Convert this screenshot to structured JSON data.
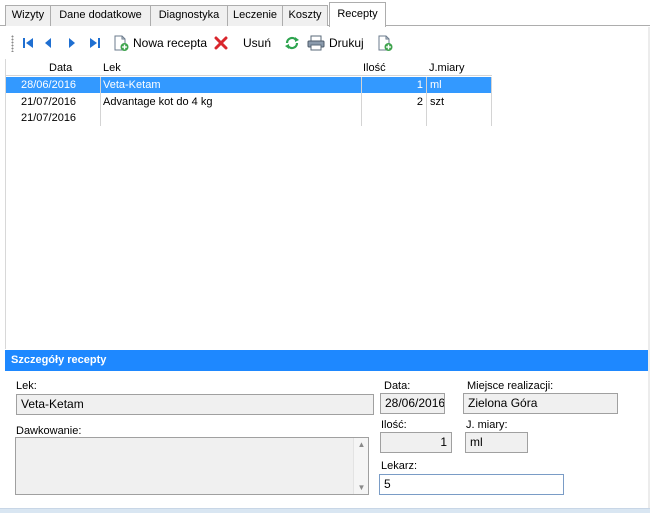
{
  "tabs": [
    {
      "label": "Wizyty",
      "active": false
    },
    {
      "label": "Dane dodatkowe",
      "active": false
    },
    {
      "label": "Diagnostyka",
      "active": false
    },
    {
      "label": "Leczenie",
      "active": false
    },
    {
      "label": "Koszty",
      "active": false
    },
    {
      "label": "Recepty",
      "active": true
    }
  ],
  "toolbar": {
    "icons": [
      "first-record-icon",
      "prev-record-icon",
      "next-record-icon",
      "last-record-icon"
    ],
    "new_label": "Nowa recepta",
    "delete_label": "Usuń",
    "print_label": "Drukuj"
  },
  "grid": {
    "columns": [
      "Data",
      "Lek",
      "Ilość",
      "J.miary"
    ],
    "rows": [
      {
        "date": "28/06/2016",
        "drug": "Veta-Ketam",
        "qty": "1",
        "unit": "ml",
        "selected": true
      },
      {
        "date": "21/07/2016",
        "drug": "Advantage kot do 4 kg",
        "qty": "2",
        "unit": "szt",
        "selected": false
      },
      {
        "date": "21/07/2016",
        "drug": "",
        "qty": "",
        "unit": "",
        "selected": false
      }
    ]
  },
  "details": {
    "title": "Szczegóły recepty",
    "drug_label": "Lek:",
    "drug_value": "Veta-Ketam",
    "date_label": "Data:",
    "date_value": "28/06/2016",
    "place_label": "Miejsce realizacji:",
    "place_value": "Zielona Góra",
    "dosage_label": "Dawkowanie:",
    "dosage_value": "",
    "qty_label": "Ilość:",
    "qty_value": "1",
    "unit_label": "J. miary:",
    "unit_value": "ml",
    "doctor_label": "Lekarz:",
    "doctor_value": "5"
  },
  "colors": {
    "accent": "#1e88ff",
    "selection": "#3399ff",
    "delete": "#d9262c",
    "nav": "#1f6fd1",
    "refresh": "#2ea44f"
  }
}
